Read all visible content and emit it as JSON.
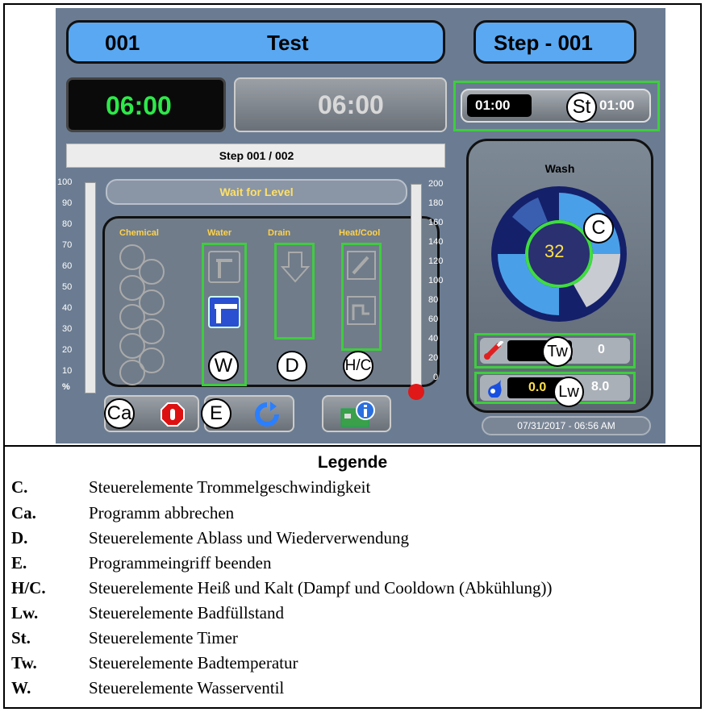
{
  "header": {
    "program_number": "001",
    "program_name": "Test",
    "step_label": "Step - 001"
  },
  "timers": {
    "main_time": "06:00",
    "secondary_time": "06:00",
    "step_time_left": "01:00",
    "step_time_right": "01:00"
  },
  "status": {
    "step_progress": "Step 001 / 002",
    "message": "Wait for Level"
  },
  "control_headers": {
    "chemical": "Chemical",
    "water": "Water",
    "drain": "Drain",
    "heat_cool": "Heat/Cool"
  },
  "left_scale": {
    "ticks": [
      "100",
      "90",
      "80",
      "70",
      "60",
      "50",
      "40",
      "30",
      "20",
      "10"
    ],
    "unit": "%"
  },
  "right_scale": {
    "ticks": [
      "200",
      "180",
      "160",
      "140",
      "120",
      "100",
      "80",
      "60",
      "40",
      "20",
      "0"
    ]
  },
  "drum": {
    "title": "Wash",
    "speed": "32"
  },
  "bath": {
    "temperature": "0",
    "temperature_target": "0",
    "level": "0.0",
    "level_target": "8.0"
  },
  "datetime": "07/31/2017 - 06:56 AM",
  "callouts": {
    "st": "St",
    "c": "C",
    "tw": "Tw",
    "lw": "Lw",
    "w": "W",
    "d": "D",
    "hc": "H/C",
    "ca": "Ca",
    "e": "E"
  },
  "legend": {
    "title": "Legende",
    "items": [
      {
        "key": "C.",
        "text": "Steuerelemente Trommelgeschwindigkeit"
      },
      {
        "key": "Ca.",
        "text": "Programm abbrechen"
      },
      {
        "key": "D.",
        "text": "Steuerelemente Ablass und Wiederverwendung"
      },
      {
        "key": "E.",
        "text": "Programmeingriff beenden"
      },
      {
        "key": "H/C.",
        "text": "Steuerelemente Heiß und Kalt (Dampf und Cooldown (Abkühlung))"
      },
      {
        "key": "Lw.",
        "text": "Steuerelemente Badfüllstand"
      },
      {
        "key": "St.",
        "text": "Steuerelemente Timer"
      },
      {
        "key": "Tw.",
        "text": "Steuerelemente Badtemperatur"
      },
      {
        "key": "W.",
        "text": "Steuerelemente Wasserventil"
      }
    ]
  },
  "colors": {
    "accent_blue": "#5aa8f2",
    "timer_green": "#2ee84a",
    "highlight_green": "#3fcc3f",
    "screen_bg": "#6b7c92"
  }
}
